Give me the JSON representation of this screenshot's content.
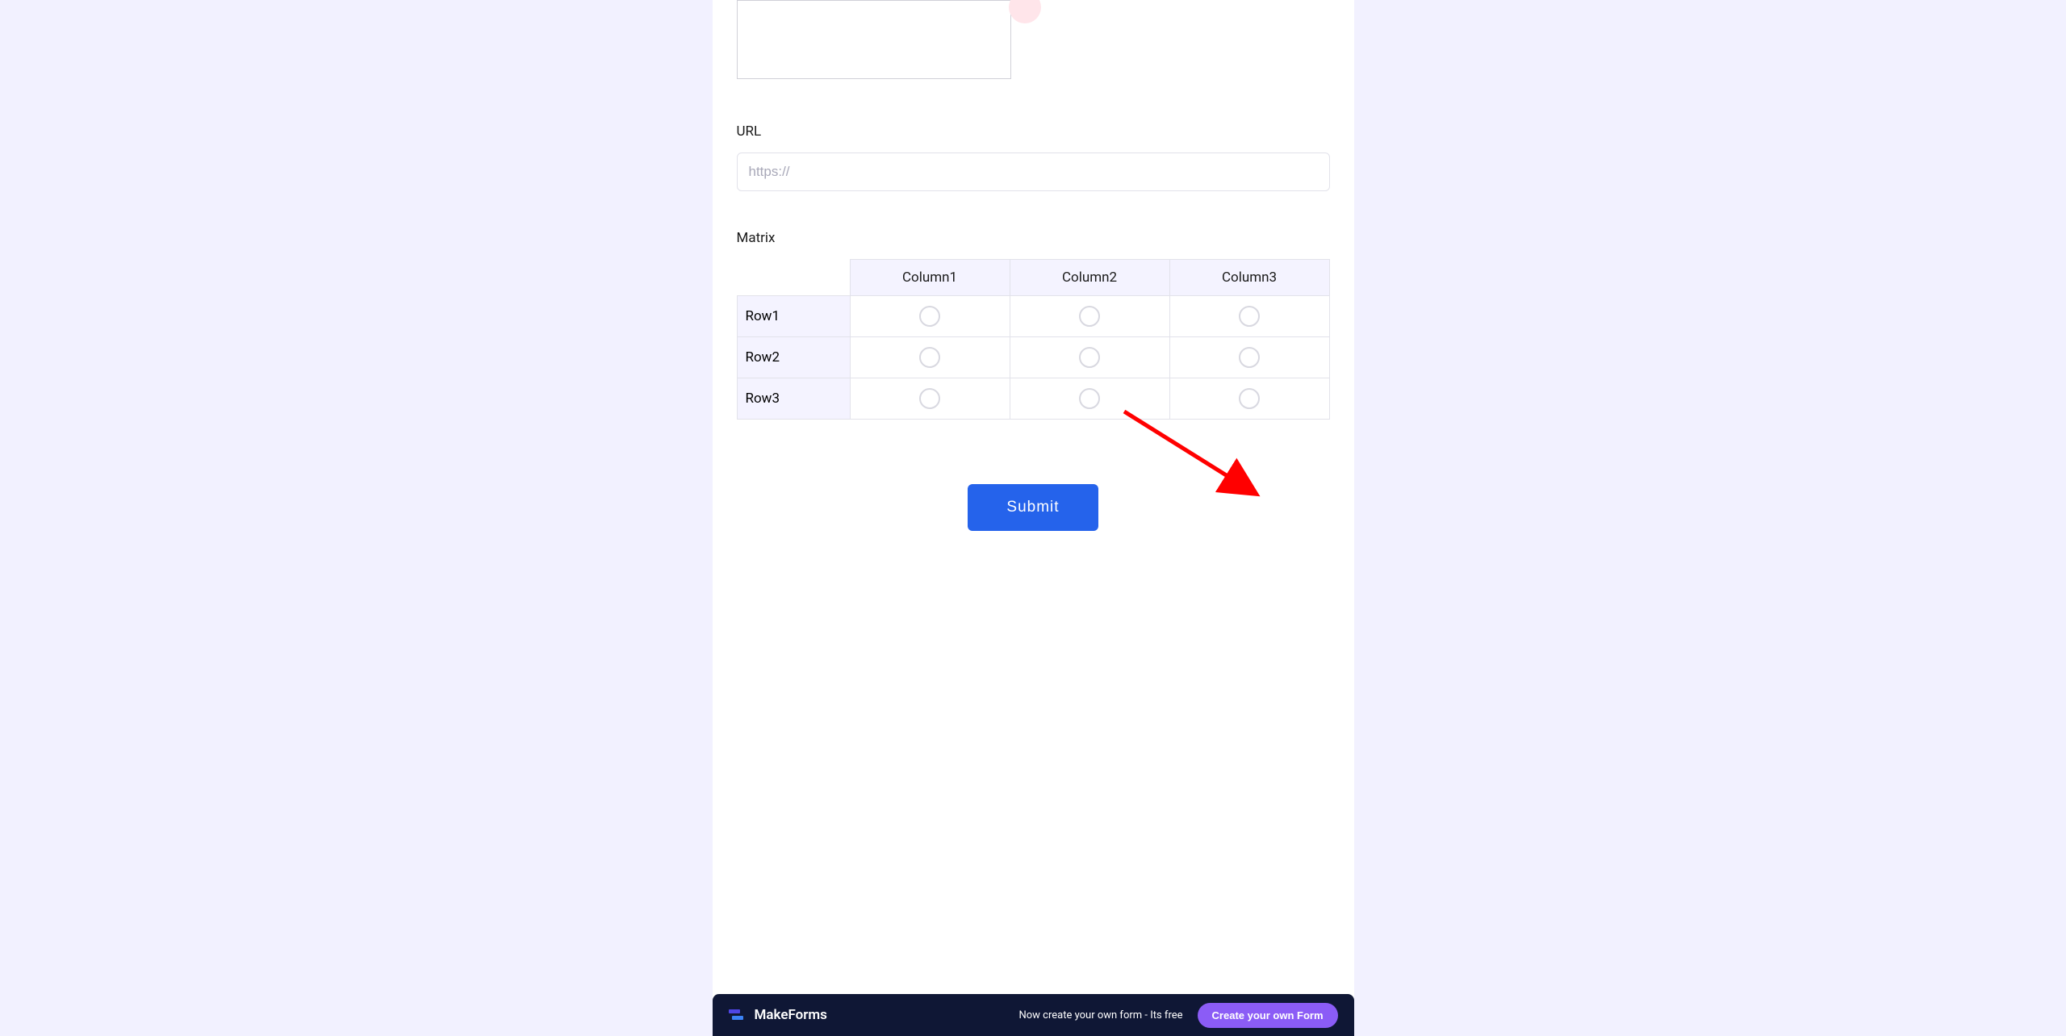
{
  "fields": {
    "url": {
      "label": "URL",
      "placeholder": "https://"
    },
    "matrix": {
      "label": "Matrix",
      "columns": [
        "Column1",
        "Column2",
        "Column3"
      ],
      "rows": [
        "Row1",
        "Row2",
        "Row3"
      ]
    }
  },
  "submit": {
    "label": "Submit"
  },
  "footer": {
    "brand": "MakeForms",
    "cta_text": "Now create your own form - Its free",
    "cta_button": "Create your own Form"
  }
}
